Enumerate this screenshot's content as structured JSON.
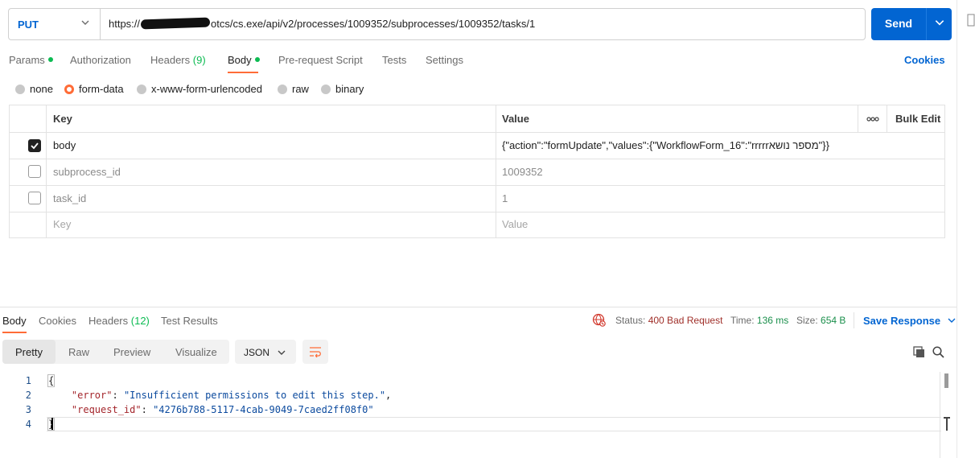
{
  "request": {
    "method": "PUT",
    "url_prefix": "https://",
    "url_suffix": "otcs/cs.exe/api/v2/processes/1009352/subprocesses/1009352/tasks/1",
    "send_label": "Send"
  },
  "tabs": [
    {
      "label": "Params",
      "dot": true
    },
    {
      "label": "Authorization"
    },
    {
      "label": "Headers",
      "count": "(9)"
    },
    {
      "label": "Body",
      "dot": true,
      "active": true
    },
    {
      "label": "Pre-request Script"
    },
    {
      "label": "Tests"
    },
    {
      "label": "Settings"
    }
  ],
  "cookies_label": "Cookies",
  "body_types": [
    {
      "label": "none"
    },
    {
      "label": "form-data",
      "selected": true
    },
    {
      "label": "x-www-form-urlencoded"
    },
    {
      "label": "raw"
    },
    {
      "label": "binary"
    }
  ],
  "table": {
    "key_header": "Key",
    "value_header": "Value",
    "more_icon": "more-horizontal-icon",
    "bulk_edit": "Bulk Edit",
    "rows": [
      {
        "checked": true,
        "key": "body",
        "value": "{\"action\":\"formUpdate\",\"values\":{\"WorkflowForm_16\":\"rrrrrמספר נושא\"}}"
      },
      {
        "checked": false,
        "key": "subprocess_id",
        "value": "1009352"
      },
      {
        "checked": false,
        "key": "task_id",
        "value": "1"
      }
    ],
    "placeholder_key": "Key",
    "placeholder_value": "Value"
  },
  "response": {
    "tabs": [
      {
        "label": "Body",
        "active": true
      },
      {
        "label": "Cookies"
      },
      {
        "label": "Headers",
        "count": "(12)"
      },
      {
        "label": "Test Results"
      }
    ],
    "status_label": "Status:",
    "status_value": "400 Bad Request",
    "time_label": "Time:",
    "time_value": "136 ms",
    "size_label": "Size:",
    "size_value": "654 B",
    "save_response": "Save Response",
    "views": [
      "Pretty",
      "Raw",
      "Preview",
      "Visualize"
    ],
    "format": "JSON",
    "lines": [
      {
        "n": "1",
        "text": "{"
      },
      {
        "n": "2",
        "key": "\"error\"",
        "val": "\"Insufficient permissions to edit this step.\"",
        "trail": ","
      },
      {
        "n": "3",
        "key": "\"request_id\"",
        "val": "\"4276b788-5117-4cab-9049-7caed2ff08f0\"",
        "trail": ""
      },
      {
        "n": "4",
        "text": "}"
      }
    ]
  },
  "colors": {
    "accent": "#ff6c37",
    "primary": "#0265d2",
    "dot": "#0cbb52"
  }
}
